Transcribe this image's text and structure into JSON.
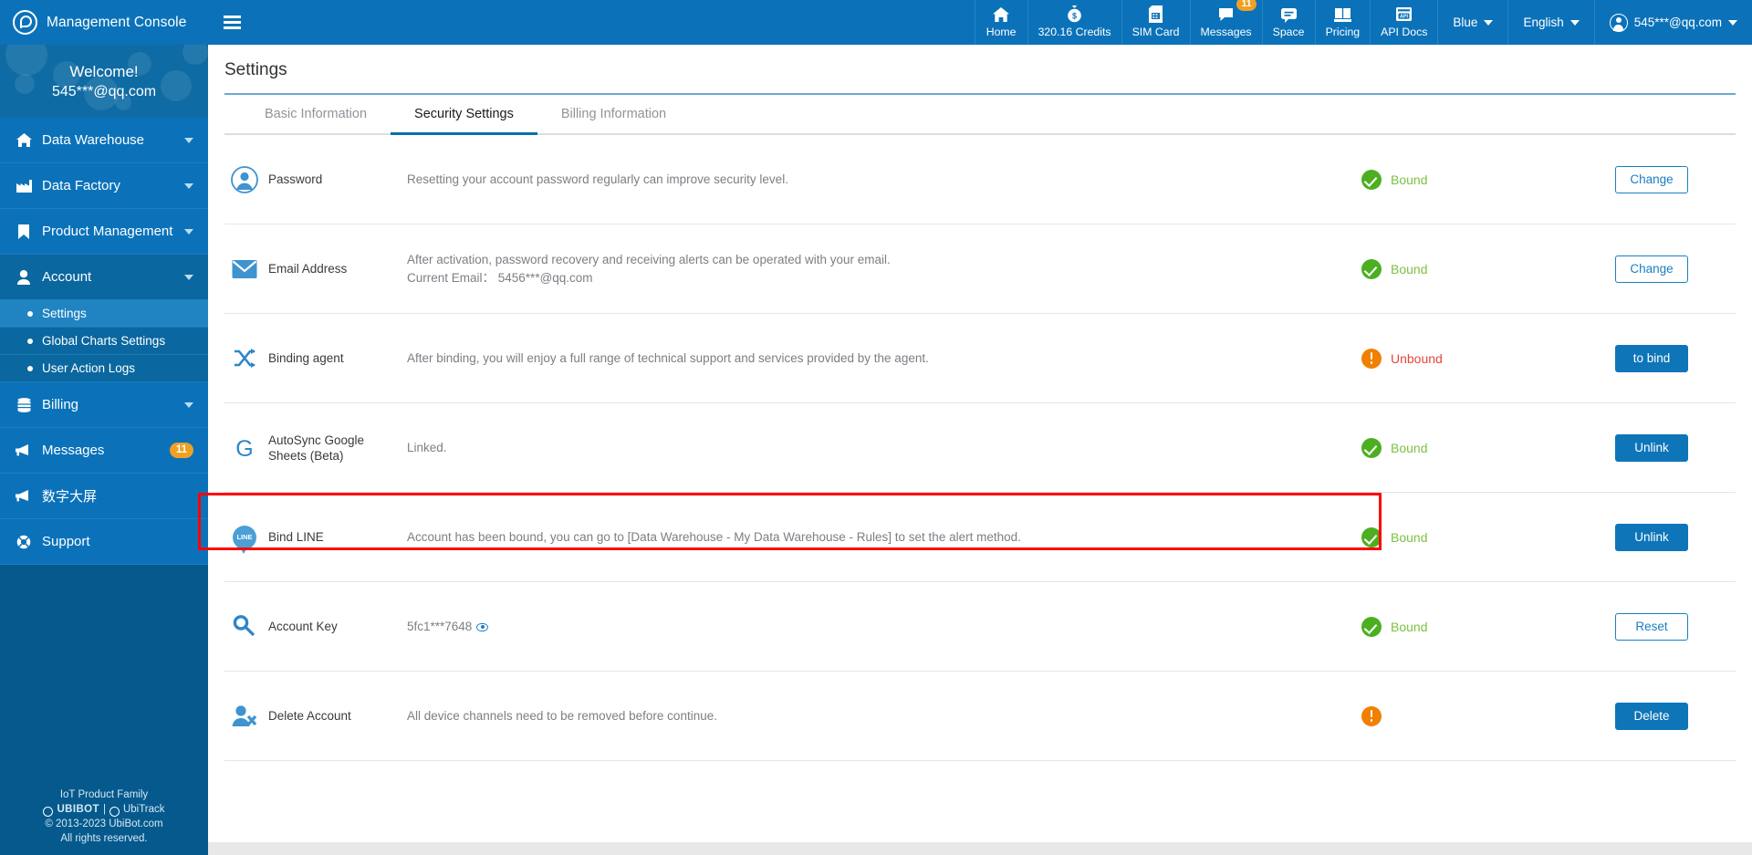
{
  "topbar": {
    "brand_title": "Management Console",
    "menu_icon": "hamburger-icon",
    "nav": [
      {
        "label": "Home",
        "icon": "home-icon"
      },
      {
        "label": "320.16 Credits",
        "icon": "money-bag-icon"
      },
      {
        "label": "SIM Card",
        "icon": "sim-card-icon"
      },
      {
        "label": "Messages",
        "icon": "message-bubble-icon",
        "badge": "11"
      },
      {
        "label": "Space",
        "icon": "chat-icon"
      },
      {
        "label": "Pricing",
        "icon": "book-icon"
      },
      {
        "label": "API Docs",
        "icon": "api-doc-icon"
      }
    ],
    "theme_select": "Blue",
    "language_select": "English",
    "account_label": "545***@qq.com"
  },
  "sidebar": {
    "welcome_line1": "Welcome!",
    "welcome_line2": "545***@qq.com",
    "items": [
      {
        "label": "Data Warehouse",
        "icon": "home-icon",
        "expandable": true
      },
      {
        "label": "Data Factory",
        "icon": "factory-icon",
        "expandable": true
      },
      {
        "label": "Product Management",
        "icon": "bookmark-icon",
        "expandable": true
      },
      {
        "label": "Account",
        "icon": "user-icon",
        "expandable": true,
        "active": true
      },
      {
        "label": "Billing",
        "icon": "database-icon",
        "expandable": true
      },
      {
        "label": "Messages",
        "icon": "megaphone-icon",
        "badge": "11"
      },
      {
        "label": "数字大屏",
        "icon": "megaphone-icon"
      },
      {
        "label": "Support",
        "icon": "lifebuoy-icon"
      }
    ],
    "sub_items": [
      {
        "label": "Settings",
        "selected": true
      },
      {
        "label": "Global Charts Settings",
        "selected": false
      },
      {
        "label": "User Action Logs",
        "selected": false
      }
    ],
    "footer": {
      "line1": "IoT Product Family",
      "brand1": "UBIBOT",
      "separator": "|",
      "brand2": "UbiTrack",
      "copyright": "© 2013-2023 UbiBot.com",
      "rights": "All rights reserved."
    }
  },
  "main": {
    "page_title": "Settings",
    "tabs": [
      {
        "label": "Basic Information",
        "active": false
      },
      {
        "label": "Security Settings",
        "active": true
      },
      {
        "label": "Billing Information",
        "active": false
      }
    ],
    "rows": [
      {
        "name": "Password",
        "icon": "user-avatar-icon",
        "desc": "Resetting your account password regularly can improve security level.",
        "desc2": "",
        "status": "Bound",
        "status_type": "ok",
        "button": "Change",
        "button_style": "outline",
        "highlighted": false
      },
      {
        "name": "Email Address",
        "icon": "envelope-icon",
        "desc": "After activation, password recovery and receiving alerts can be operated with your email.",
        "desc2": "Current Email： 5456***@qq.com",
        "status": "Bound",
        "status_type": "ok",
        "button": "Change",
        "button_style": "outline",
        "highlighted": false
      },
      {
        "name": "Binding agent",
        "icon": "shuffle-icon",
        "desc": "After binding, you will enjoy a full range of technical support and services provided by the agent.",
        "desc2": "",
        "status": "Unbound",
        "status_type": "bad",
        "button": "to bind",
        "button_style": "solid",
        "highlighted": false
      },
      {
        "name": "AutoSync Google Sheets (Beta)",
        "icon": "google-g-icon",
        "desc": "Linked.",
        "desc2": "",
        "status": "Bound",
        "status_type": "ok",
        "button": "Unlink",
        "button_style": "solid",
        "highlighted": false
      },
      {
        "name": "Bind LINE",
        "icon": "line-icon",
        "icon_text": "LINE",
        "desc": "Account has been bound, you can go to [Data Warehouse - My Data Warehouse - Rules] to set the alert method.",
        "desc2": "",
        "status": "Bound",
        "status_type": "ok",
        "button": "Unlink",
        "button_style": "solid",
        "highlighted": true
      },
      {
        "name": "Account Key",
        "icon": "key-icon",
        "desc": "5fc1***7648",
        "desc2": "",
        "has_eye": true,
        "status": "Bound",
        "status_type": "ok",
        "button": "Reset",
        "button_style": "outline",
        "highlighted": false
      },
      {
        "name": "Delete Account",
        "icon": "user-delete-icon",
        "desc": "All device channels need to be removed before continue.",
        "desc2": "",
        "status": "",
        "status_type": "bad-noted",
        "button": "Delete",
        "button_style": "solid",
        "highlighted": false
      }
    ]
  },
  "colors": {
    "brand_blue": "#0b72b9",
    "sidebar_dark": "#05598c",
    "accent_blue": "#0d75b8",
    "status_ok": "#7cc142",
    "status_bad": "#e8453c",
    "warn_orange": "#f08000",
    "highlight_red": "#ff0000",
    "badge_orange": "#f0a024"
  }
}
